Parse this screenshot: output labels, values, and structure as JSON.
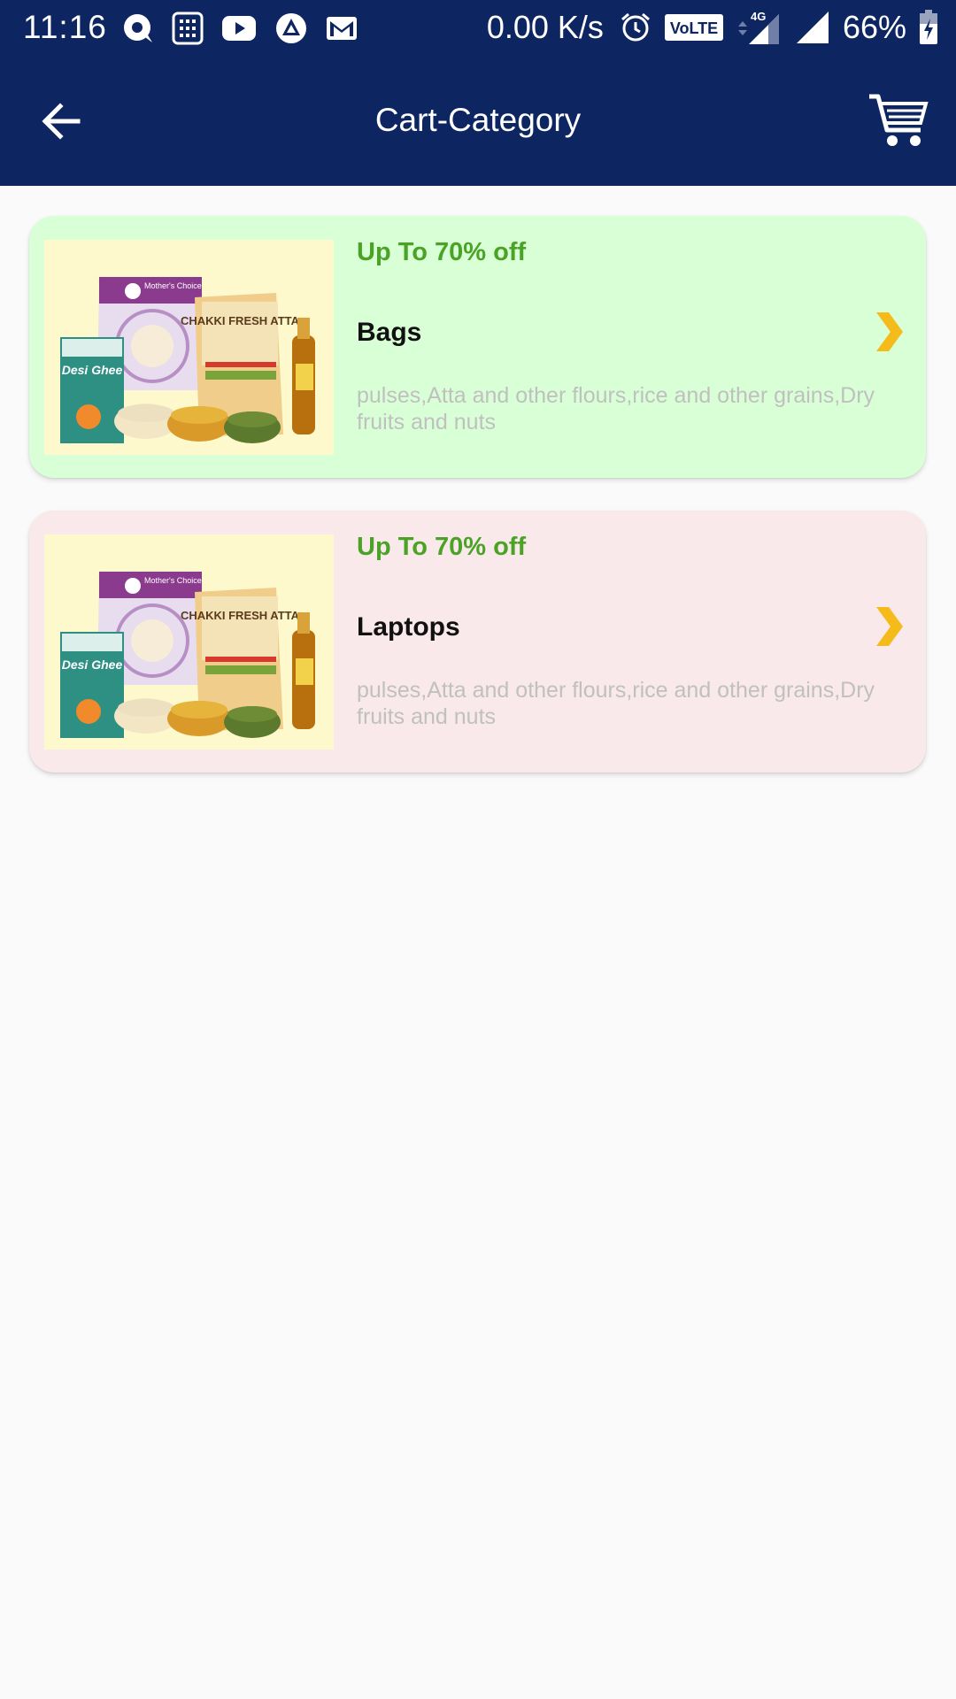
{
  "status_bar": {
    "time": "11:16",
    "net_speed": "0.00 K/s",
    "battery": "66%",
    "left_icons": [
      "chat-icon",
      "calculator-icon",
      "youtube-icon",
      "drive-icon",
      "gmail-icon"
    ],
    "right_icons": [
      "alarm-icon",
      "volte-icon",
      "signal-4g-icon",
      "signal-icon",
      "battery-charging-icon"
    ],
    "volte_label": "VoLTE",
    "network_label": "4G"
  },
  "app_bar": {
    "title": "Cart-Category",
    "back_icon": "arrow-back-icon",
    "cart_icon": "cart-icon",
    "background_color": "#0d2561"
  },
  "categories": [
    {
      "offer": "Up To 70% off",
      "name": "Bags",
      "description": "pulses,Atta and other flours,rice and other grains,Dry fruits and nuts",
      "background_color": "#d9ffd6",
      "thumb_labels": {
        "brand": "Mother's Choice",
        "atta": "CHAKKI FRESH ATTA",
        "ghee": "Desi Ghee"
      }
    },
    {
      "offer": "Up To 70% off",
      "name": "Laptops",
      "description": "pulses,Atta and other flours,rice and other grains,Dry fruits and nuts",
      "background_color": "#fae9ea",
      "thumb_labels": {
        "brand": "Mother's Choice",
        "atta": "CHAKKI FRESH ATTA",
        "ghee": "Desi Ghee"
      }
    }
  ],
  "colors": {
    "offer_text": "#4aa326",
    "chevron": "#f5bb1a",
    "description": "#c0c0c0"
  }
}
